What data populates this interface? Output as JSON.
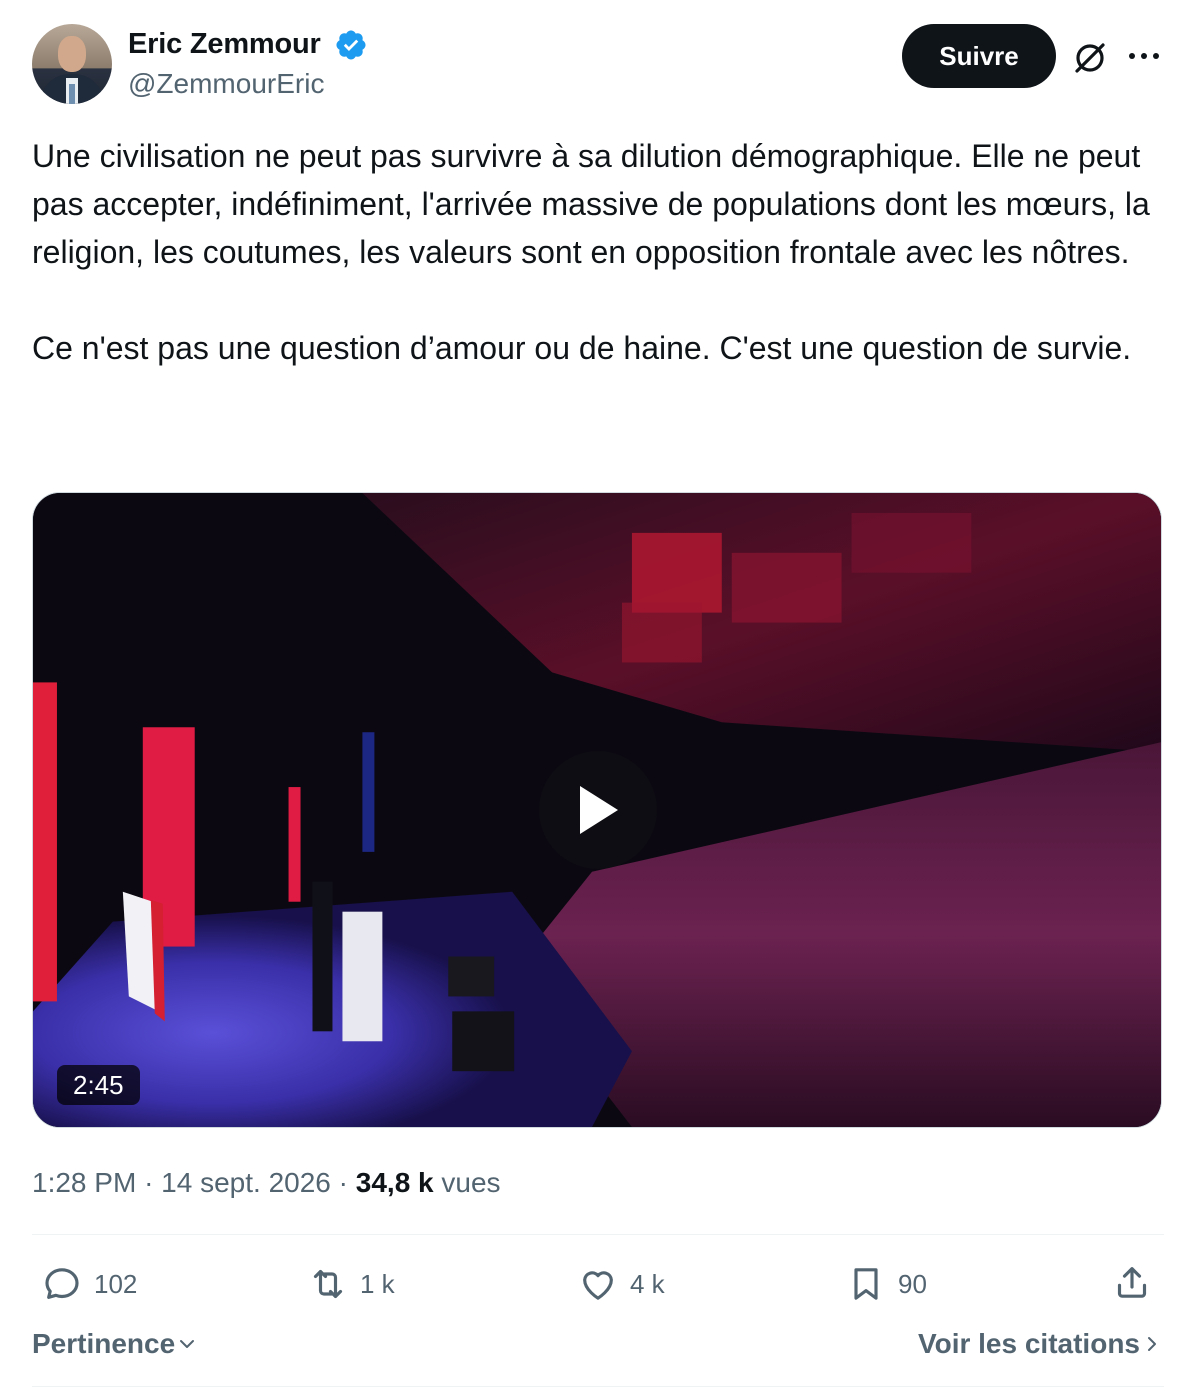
{
  "author": {
    "name": "Eric Zemmour",
    "handle": "@ZemmourEric",
    "verified": true
  },
  "header": {
    "follow_label": "Suivre",
    "icons": [
      "grok-icon",
      "more-icon"
    ]
  },
  "tweet": {
    "paragraphs": [
      "Une civilisation ne peut pas survivre à sa dilution démographique. Elle ne peut pas accepter, indéfiniment, l'arrivée massive de populations dont les mœurs, la religion, les coutumes, les valeurs sont en opposition frontale avec les nôtres.",
      "Ce n'est pas une question d’amour ou de haine. C'est une question de survie."
    ]
  },
  "media": {
    "type": "video",
    "duration": "2:45"
  },
  "meta": {
    "time": "1:28 PM",
    "separator": "·",
    "date": "14 sept. 2026",
    "views_count": "34,8 k",
    "views_label": "vues"
  },
  "actions": {
    "replies": "102",
    "reposts": "1 k",
    "likes": "4 k",
    "bookmarks": "90"
  },
  "footer": {
    "sort_label": "Pertinence",
    "quotes_label": "Voir les citations"
  },
  "colors": {
    "text": "#0f1419",
    "secondary": "#536471",
    "verified": "#1d9bf0",
    "button": "#0f1419"
  }
}
